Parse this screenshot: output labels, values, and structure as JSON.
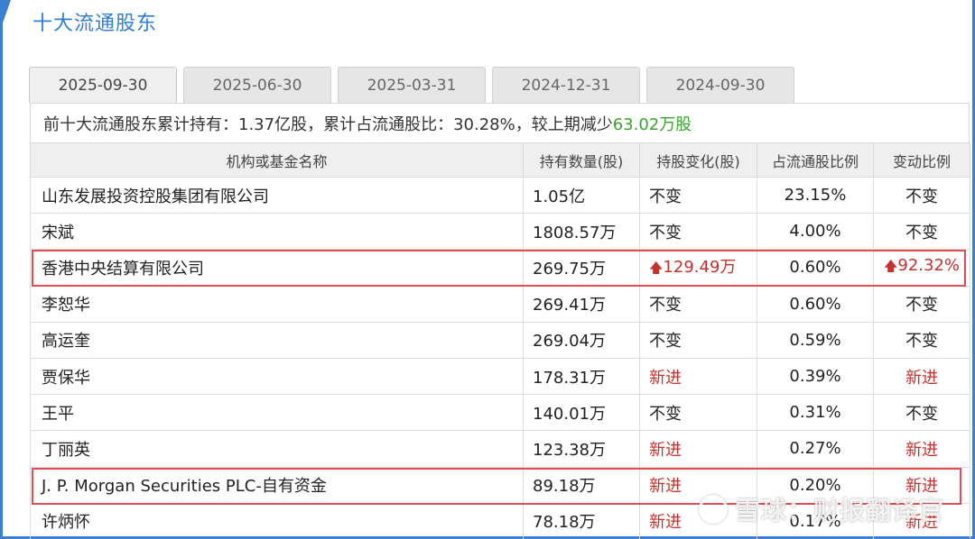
{
  "header": {
    "title": "十大流通股东"
  },
  "tabs": [
    {
      "label": "2025-09-30"
    },
    {
      "label": "2025-06-30"
    },
    {
      "label": "2025-03-31"
    },
    {
      "label": "2024-12-31"
    },
    {
      "label": "2024-09-30"
    }
  ],
  "summary": {
    "prefix": "前十大流通股东累计持有：1.37亿股，累计占流通股比：30.28%，较上期减少",
    "change": "63.02万股"
  },
  "table": {
    "headers": [
      "机构或基金名称",
      "持有数量(股)",
      "持股变化(股)",
      "占流通股比例",
      "变动比例"
    ],
    "rows": [
      {
        "name": "山东发展投资控股集团有限公司",
        "qty": "1.05亿",
        "change": "不变",
        "ratio": "23.15%",
        "delta": "不变"
      },
      {
        "name": "宋斌",
        "qty": "1808.57万",
        "change": "不变",
        "ratio": "4.00%",
        "delta": "不变"
      },
      {
        "name": "香港中央结算有限公司",
        "qty": "269.75万",
        "change": "129.49万",
        "ratio": "0.60%",
        "delta": "92.32%"
      },
      {
        "name": "李恕华",
        "qty": "269.41万",
        "change": "不变",
        "ratio": "0.60%",
        "delta": "不变"
      },
      {
        "name": "高运奎",
        "qty": "269.04万",
        "change": "不变",
        "ratio": "0.59%",
        "delta": "不变"
      },
      {
        "name": "贾保华",
        "qty": "178.31万",
        "change": "新进",
        "ratio": "0.39%",
        "delta": "新进"
      },
      {
        "name": "王平",
        "qty": "140.01万",
        "change": "不变",
        "ratio": "0.31%",
        "delta": "不变"
      },
      {
        "name": "丁丽英",
        "qty": "123.38万",
        "change": "新进",
        "ratio": "0.27%",
        "delta": "新进"
      },
      {
        "name": "J. P. Morgan Securities PLC-自有资金",
        "qty": "89.18万",
        "change": "新进",
        "ratio": "0.20%",
        "delta": "新进"
      },
      {
        "name": "许炳怀",
        "qty": "78.18万",
        "change": "新进",
        "ratio": "0.17%",
        "delta": "新进"
      }
    ]
  },
  "arrow": "🡅",
  "watermark": {
    "text": "雪球：财报翻译官"
  },
  "colors": {
    "accent": "#3b7fd1",
    "title": "#2f7fd6",
    "red": "#c9302c",
    "green": "#3aa42f",
    "highlight": "#e34b50"
  }
}
